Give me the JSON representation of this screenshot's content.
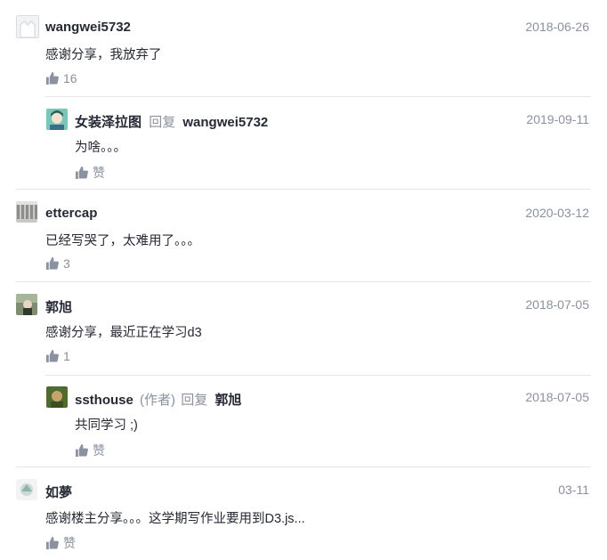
{
  "comments": [
    {
      "user": "wangwei5732",
      "date": "2018-06-26",
      "text": "感谢分享，我放弃了",
      "likes": "16",
      "replies": [
        {
          "user": "女装泽拉图",
          "reply_label": "回复",
          "reply_to": "wangwei5732",
          "date": "2019-09-11",
          "text": "为啥。。。",
          "like_label": "赞"
        }
      ]
    },
    {
      "user": "ettercap",
      "date": "2020-03-12",
      "text": "已经写哭了，太难用了。。。",
      "likes": "3"
    },
    {
      "user": "郭旭",
      "date": "2018-07-05",
      "text": "感谢分享，最近正在学习d3",
      "likes": "1",
      "replies": [
        {
          "user": "ssthouse",
          "author_tag": "(作者)",
          "reply_label": "回复",
          "reply_to": "郭旭",
          "date": "2018-07-05",
          "text": "共同学习 ;)",
          "like_label": "赞"
        }
      ]
    },
    {
      "user": "如夢",
      "date": "03-11",
      "text": "感谢楼主分享。。。这学期写作业要用到D3.js...",
      "like_label": "赞"
    }
  ],
  "icons": {
    "like": "thumbs-up-icon"
  },
  "colors": {
    "muted": "#8a919f",
    "text": "#252933",
    "divider": "#e4e6eb"
  }
}
